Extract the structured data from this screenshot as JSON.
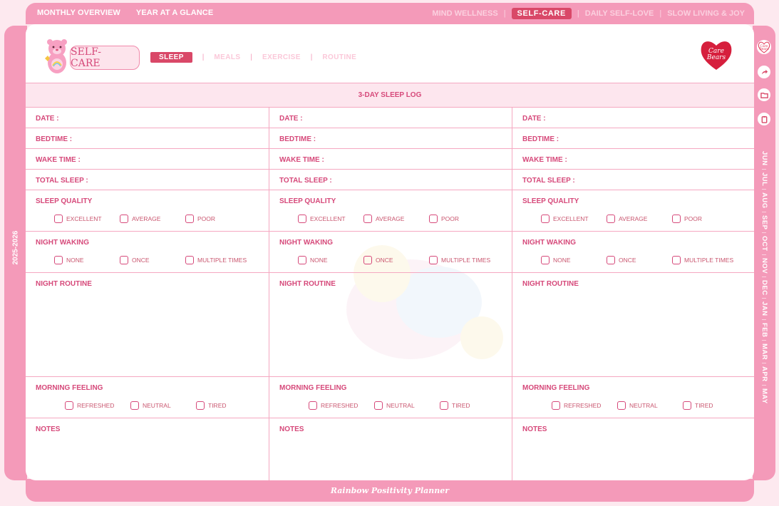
{
  "topnav": {
    "left": [
      "MONTHLY OVERVIEW",
      "YEAR AT A GLANCE"
    ],
    "right": [
      "MIND WELLNESS",
      "SELF-CARE",
      "DAILY SELF-LOVE",
      "SLOW LIVING & JOY"
    ],
    "active": "SELF-CARE"
  },
  "year": "2025-2026",
  "side_icons": [
    "care-bears-logo-icon",
    "share-icon",
    "folder-icon",
    "clipboard-icon"
  ],
  "months": [
    "JUN",
    "JUL",
    "AUG",
    "SEP",
    "OCT",
    "NOV",
    "DEC",
    "JAN",
    "FEB",
    "MAR",
    "APR",
    "MAY"
  ],
  "header": {
    "section_title": "SELF-CARE",
    "logo_text_line1": "Care",
    "logo_text_line2": "Bears",
    "subnav": [
      "SLEEP",
      "MEALS",
      "EXERCISE",
      "ROUTINE"
    ],
    "subnav_active": "SLEEP"
  },
  "log_title": "3-DAY SLEEP LOG",
  "fields": {
    "date": "DATE :",
    "bedtime": "BEDTIME :",
    "wake_time": "WAKE TIME :",
    "total_sleep": "TOTAL SLEEP :",
    "sleep_quality": "SLEEP QUALITY",
    "night_waking": "NIGHT WAKING",
    "night_routine": "NIGHT ROUTINE",
    "morning_feeling": "MORNING FEELING",
    "notes": "NOTES"
  },
  "options": {
    "sleep_quality": [
      "EXCELLENT",
      "AVERAGE",
      "POOR"
    ],
    "night_waking": [
      "NONE",
      "ONCE",
      "MULTIPLE TIMES"
    ],
    "morning_feeling": [
      "REFRESHED",
      "NEUTRAL",
      "TIRED"
    ]
  },
  "footer": "Rainbow Positivity Planner",
  "colors": {
    "frame": "#f49ab9",
    "accent": "#d94868",
    "text": "#d6497a"
  }
}
